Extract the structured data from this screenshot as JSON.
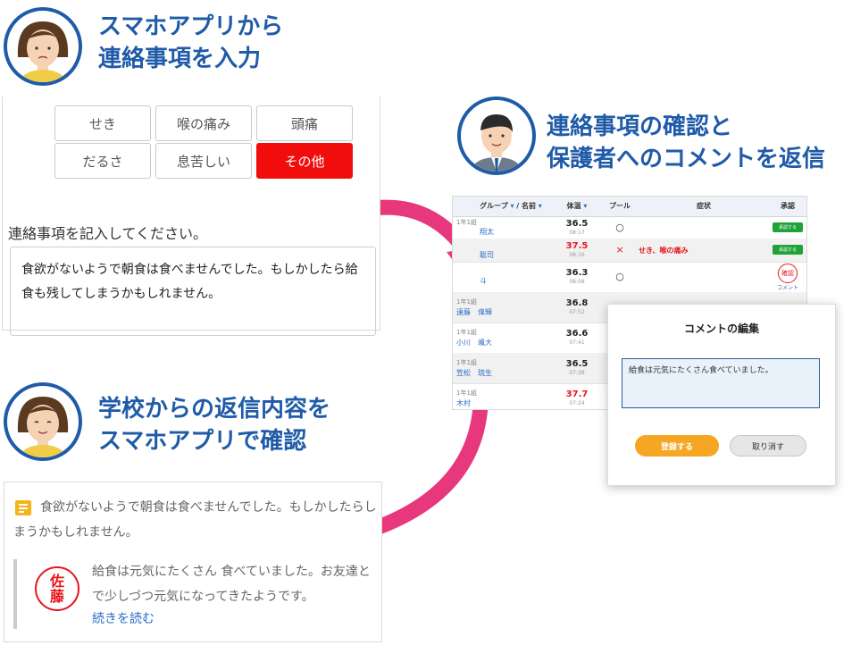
{
  "colors": {
    "heading": "#1f5ba8",
    "active_chip": "#f20d0d",
    "arrow": "#e8387d",
    "approve": "#1fa337",
    "hot": "#e8151b"
  },
  "section1": {
    "heading_line1": "スマホアプリから",
    "heading_line2": "連絡事項を入力"
  },
  "symptoms": {
    "chips": [
      "せき",
      "喉の痛み",
      "頭痛",
      "だるさ",
      "息苦しい",
      "その他"
    ],
    "selected": "その他"
  },
  "memo": {
    "prompt": "連絡事項を記入してください。",
    "text": "食欲がないようで朝食は食べませんでした。もしかしたら給食も残してしまうかもしれません。"
  },
  "section2": {
    "heading_line1": "連絡事項の確認と",
    "heading_line2": "保護者へのコメントを返信"
  },
  "table": {
    "headers": {
      "group": "グループ",
      "name": "名前",
      "temp": "体温",
      "pool": "プール",
      "symptom": "症状",
      "approve": "承認"
    },
    "rows": [
      {
        "class": "1年1組",
        "name": "翔太",
        "temp": "36.5",
        "time": "08:17",
        "pool": "○",
        "symptom": "",
        "status": "承認する"
      },
      {
        "class": "",
        "name": "聡司",
        "temp": "37.5",
        "time": "08:16",
        "pool": "×",
        "symptom": "せき、喉の痛み",
        "status": "承認する"
      },
      {
        "class": "",
        "name": "斗",
        "temp": "36.3",
        "time": "08:08",
        "pool": "○",
        "symptom": "",
        "status": "コメント"
      },
      {
        "class": "1年1組",
        "name": "遠藤　偉輝",
        "temp": "36.8",
        "time": "07:52",
        "pool": "",
        "symptom": "",
        "status": ""
      },
      {
        "class": "1年1組",
        "name": "小川　颯大",
        "temp": "36.6",
        "time": "07:41",
        "pool": "",
        "symptom": "",
        "status": ""
      },
      {
        "class": "1年1組",
        "name": "笠松　琉生",
        "temp": "36.5",
        "time": "07:38",
        "pool": "",
        "symptom": "",
        "status": ""
      },
      {
        "class": "1年1組",
        "name": "木村",
        "temp": "37.7",
        "time": "07:24",
        "pool": "",
        "symptom": "",
        "status": ""
      }
    ],
    "stamp_char": "確認"
  },
  "modal": {
    "title": "コメントの編集",
    "text": "給食は元気にたくさん食べていました。",
    "ok": "登録する",
    "cancel": "取り消す"
  },
  "section3": {
    "heading_line1": "学校からの返信内容を",
    "heading_line2": "スマホアプリで確認"
  },
  "reply_view": {
    "parent_msg": "食欲がないようで朝食は食べませんでした。もしかしたらしまうかもしれません。",
    "stamp_top": "佐",
    "stamp_bottom": "藤",
    "reply_text": "給食は元気にたくさん 食べていました。お友達とで少しづつ元気になってきたようです。",
    "read_more": "続きを読む"
  }
}
